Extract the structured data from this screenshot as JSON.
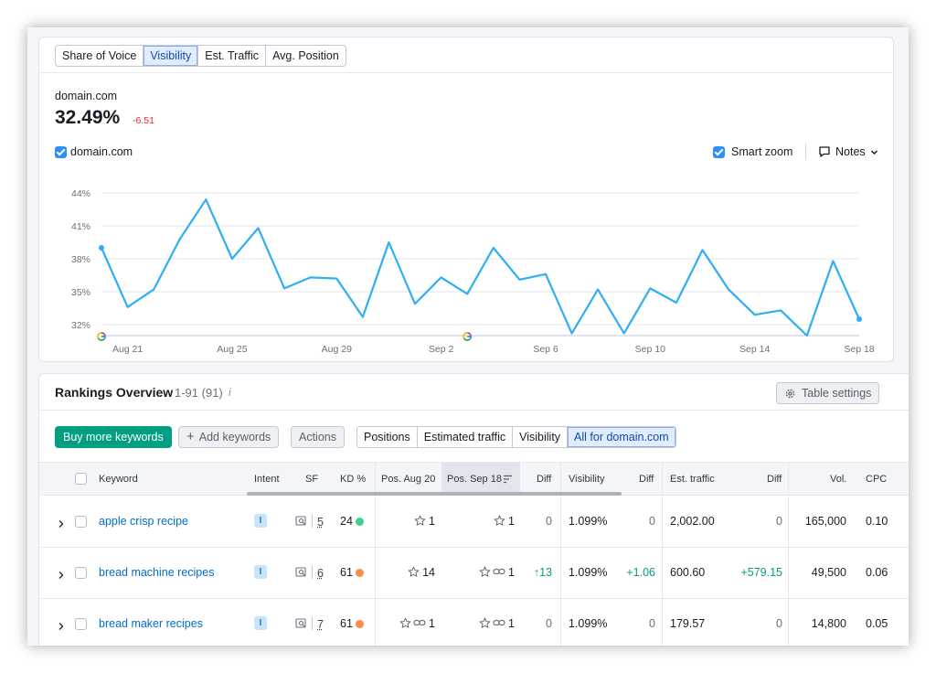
{
  "top_tabs": [
    "Share of Voice",
    "Visibility",
    "Est. Traffic",
    "Avg. Position"
  ],
  "active_tab": 1,
  "domain_label": "domain.com",
  "metric_value": "32.49%",
  "metric_delta": "-6.51",
  "legend_label": "domain.com",
  "smart_zoom_label": "Smart zoom",
  "notes_label": "Notes",
  "chart_data": {
    "type": "line",
    "ylim": [
      31,
      45
    ],
    "y_ticks": [
      "44%",
      "41%",
      "38%",
      "35%",
      "32%"
    ],
    "y_tick_values": [
      44,
      41,
      38,
      35,
      32
    ],
    "x_ticks": [
      "Aug 21",
      "Aug 25",
      "Aug 29",
      "Sep 2",
      "Sep 6",
      "Sep 10",
      "Sep 14",
      "Sep 18"
    ],
    "x_tick_index": [
      1,
      5,
      9,
      13,
      17,
      21,
      25,
      29
    ],
    "google_markers_index": [
      0,
      14
    ],
    "color": "#2eaef5",
    "series": [
      {
        "values": [
          39.0,
          33.6,
          35.2,
          39.8,
          43.4,
          38.0,
          40.8,
          35.3,
          36.3,
          36.2,
          32.7,
          39.5,
          33.9,
          36.3,
          34.8,
          39.0,
          36.1,
          36.6,
          31.2,
          35.2,
          31.2,
          35.3,
          34.0,
          38.8,
          35.2,
          32.9,
          33.3,
          31.0,
          37.8,
          32.5
        ]
      }
    ]
  },
  "rankings": {
    "title": "Rankings Overview",
    "range": "1-91 (91)",
    "info_glyph": "i",
    "table_settings_label": "Table settings",
    "buy_label": "Buy more keywords",
    "add_label": "Add keywords",
    "actions_label": "Actions",
    "view_tabs": [
      "Positions",
      "Estimated traffic",
      "Visibility",
      "All for domain.com"
    ],
    "active_view_tab": 3,
    "columns": {
      "keyword": "Keyword",
      "intent": "Intent",
      "sf": "SF",
      "kd": "KD %",
      "pos_a": "Pos. Aug 20",
      "pos_b": "Pos. Sep 18",
      "diff1": "Diff",
      "visibility": "Visibility",
      "diff2": "Diff",
      "traffic": "Est. traffic",
      "diff3": "Diff",
      "vol": "Vol.",
      "cpc": "CPC"
    },
    "rows": [
      {
        "keyword": "apple crisp recipe",
        "intent": "I",
        "sf": "5",
        "kd": "24",
        "kd_color": "#3ecf8e",
        "pos_a": "1",
        "pos_a_link": false,
        "pos_b": "1",
        "pos_b_link": false,
        "diff1": "0",
        "diff1_up": false,
        "visibility": "1.099%",
        "diff2": "0",
        "diff2_up": false,
        "traffic": "2,002.00",
        "diff3": "0",
        "diff3_up": false,
        "vol": "165,000",
        "cpc": "0.10"
      },
      {
        "keyword": "bread machine recipes",
        "intent": "I",
        "sf": "6",
        "kd": "61",
        "kd_color": "#ff8c43",
        "pos_a": "14",
        "pos_a_link": false,
        "pos_b": "1",
        "pos_b_link": true,
        "diff1": "13",
        "diff1_up": true,
        "visibility": "1.099%",
        "diff2": "+1.06",
        "diff2_up": true,
        "traffic": "600.60",
        "diff3": "+579.15",
        "diff3_up": true,
        "vol": "49,500",
        "cpc": "0.06"
      },
      {
        "keyword": "bread maker recipes",
        "intent": "I",
        "sf": "7",
        "kd": "61",
        "kd_color": "#ff8c43",
        "pos_a": "1",
        "pos_a_link": true,
        "pos_b": "1",
        "pos_b_link": true,
        "diff1": "0",
        "diff1_up": false,
        "visibility": "1.099%",
        "diff2": "0",
        "diff2_up": false,
        "traffic": "179.57",
        "diff3": "0",
        "diff3_up": false,
        "vol": "14,800",
        "cpc": "0.05"
      }
    ]
  }
}
